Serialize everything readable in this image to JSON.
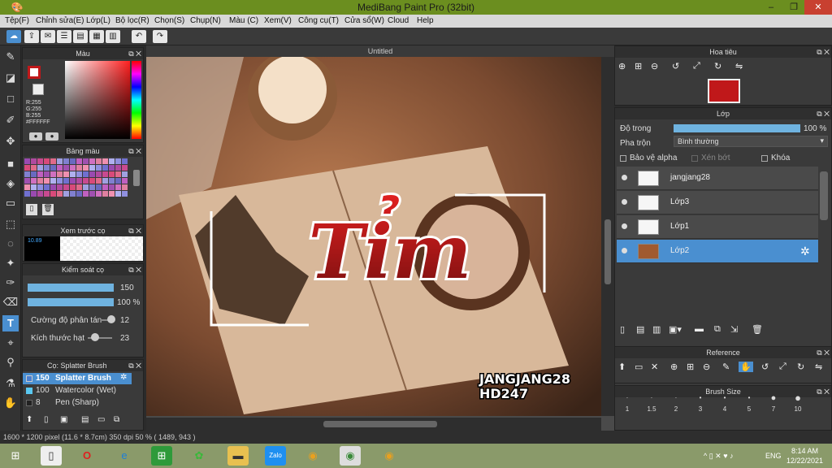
{
  "window": {
    "title": "MediBang Paint Pro (32bit)",
    "minimize": "–",
    "maximize": "❐",
    "close": "✕"
  },
  "menu": [
    "Tệp(F)",
    "Chỉnh sửa(E)",
    "Lớp(L)",
    "Bộ lọc(R)",
    "Chọn(S)",
    "Chụp(N)",
    "Màu (C)",
    "Xem(V)",
    "Công cụ(T)",
    "Cửa sổ(W)",
    "Cloud",
    "Help"
  ],
  "color_panel": {
    "title": "Màu",
    "r": "R:255",
    "g": "G:255",
    "b": "B:255",
    "hex": "#FFFFFF"
  },
  "palette_panel": {
    "title": "Bảng màu"
  },
  "preview_panel": {
    "title": "Xem trước cọ",
    "size": "10.89"
  },
  "brush_control": {
    "title": "Kiểm soát cọ",
    "size": "150",
    "opacity": "100 %",
    "scatter_label": "Cường độ phân tán",
    "scatter_value": "12",
    "grain_label": "Kích thước hạt",
    "grain_value": "23",
    "size_fill": 1.0,
    "opacity_fill": 1.0
  },
  "brush_panel": {
    "title": "Cọ: Splatter Brush",
    "items": [
      {
        "size": "150",
        "name": "Splatter Brush",
        "color": "#4a7fd0"
      },
      {
        "size": "100",
        "name": "Watercolor (Wet)",
        "color": "#5ac8f0"
      },
      {
        "size": "8",
        "name": "Pen (Sharp)",
        "color": "#222222"
      }
    ]
  },
  "canvas": {
    "tab": "Untitled",
    "word": "Tỉm",
    "tag1": "JANGJANG28",
    "tag2": "HD247"
  },
  "navigator": {
    "title": "Hoa tiêu"
  },
  "layer_panel": {
    "title": "Lớp",
    "opacity_label": "Độ trong",
    "opacity_value": "100 %",
    "blend_label": "Pha trộn",
    "blend_value": "Bình thường",
    "protect_alpha": "Bảo vệ alpha",
    "clipping": "Xén bớt",
    "lock": "Khóa",
    "layers": [
      "jangjang28",
      "Lớp3",
      "Lớp1",
      "Lớp2"
    ]
  },
  "reference": {
    "title": "Reference"
  },
  "brush_size": {
    "title": "Brush Size",
    "sizes": [
      "1",
      "1.5",
      "2",
      "3",
      "4",
      "5",
      "7",
      "10"
    ]
  },
  "status": "1600 * 1200 pixel  (11.6 * 8.7cm)  350 dpi  50 %  ( 1489, 943 )",
  "taskbar": {
    "lang": "ENG",
    "time": "8:14 AM",
    "date": "12/22/2021"
  },
  "colors": {
    "accent": "#4a8fd0",
    "title": "#6b8e1f",
    "red": "#c0181a"
  }
}
